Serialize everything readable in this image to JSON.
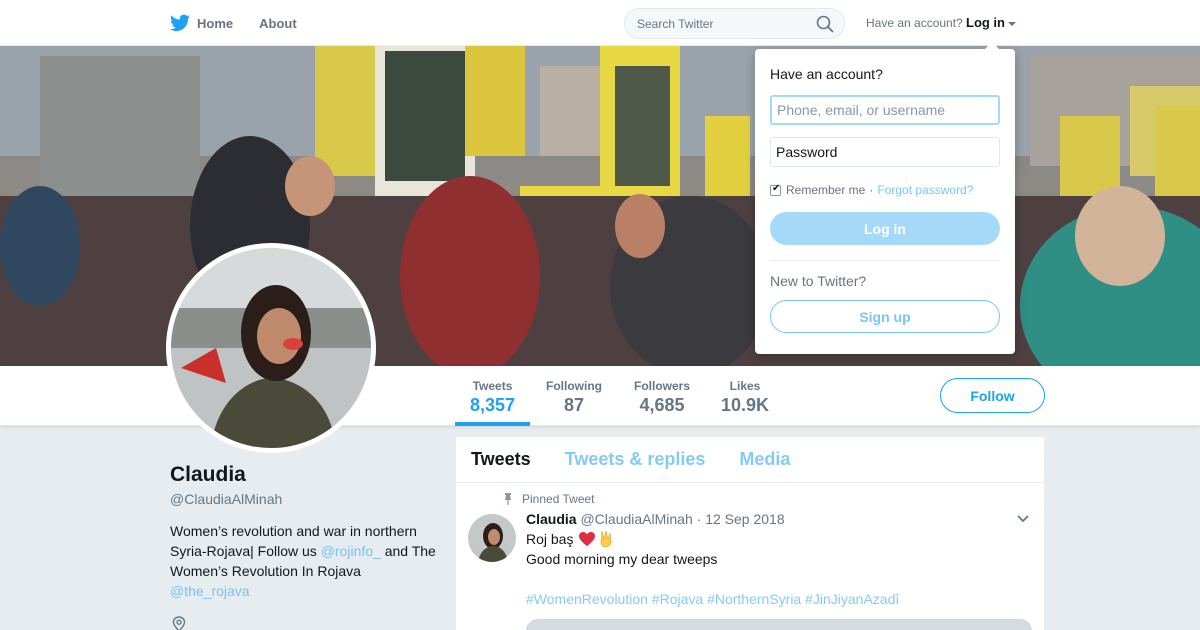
{
  "nav": {
    "home_label": "Home",
    "about_label": "About",
    "search_placeholder": "Search Twitter",
    "have_account": "Have an account?",
    "login_label": "Log in",
    "icons": {
      "brand": "twitter-bird-icon",
      "search": "search-icon",
      "caret": "caret-down-icon"
    }
  },
  "profile": {
    "name": "Claudia",
    "handle": "@ClaudiaAlMinah",
    "bio_text1": "Women’s revolution and war in northern Syria-Rojava| Follow us",
    "bio_link1": "@rojinfo_",
    "bio_text2": "and The Women’s Revolution In Rojava",
    "bio_link2": "@the_rojava",
    "location_icon": "location-pin-icon"
  },
  "stats": [
    {
      "label": "Tweets",
      "value": "8,357"
    },
    {
      "label": "Following",
      "value": "87"
    },
    {
      "label": "Followers",
      "value": "4,685"
    },
    {
      "label": "Likes",
      "value": "10.9K"
    }
  ],
  "follow_label": "Follow",
  "timeline": {
    "tabs": [
      "Tweets",
      "Tweets & replies",
      "Media"
    ],
    "pinned_label": "Pinned Tweet",
    "tweet": {
      "author": "Claudia",
      "handle": "@ClaudiaAlMinah",
      "date": "· 12 Sep 2018",
      "line1": "Roj baş",
      "line2": "Good morning my dear tweeps",
      "tags": "#WomenRevolution #Rojava #NorthernSyria #JinJiyanAzadî"
    }
  },
  "login_dropdown": {
    "title": "Have an account?",
    "username_placeholder": "Phone, email, or username",
    "password_placeholder": "Password",
    "remember": "Remember me",
    "separator": "·",
    "forgot": "Forgot password?",
    "login_button": "Log in",
    "new_to": "New to Twitter?",
    "signup_button": "Sign up"
  },
  "colors": {
    "accent": "#1da1f2",
    "background": "#e6ecf0",
    "text": "#14171a",
    "muted": "#657786"
  }
}
